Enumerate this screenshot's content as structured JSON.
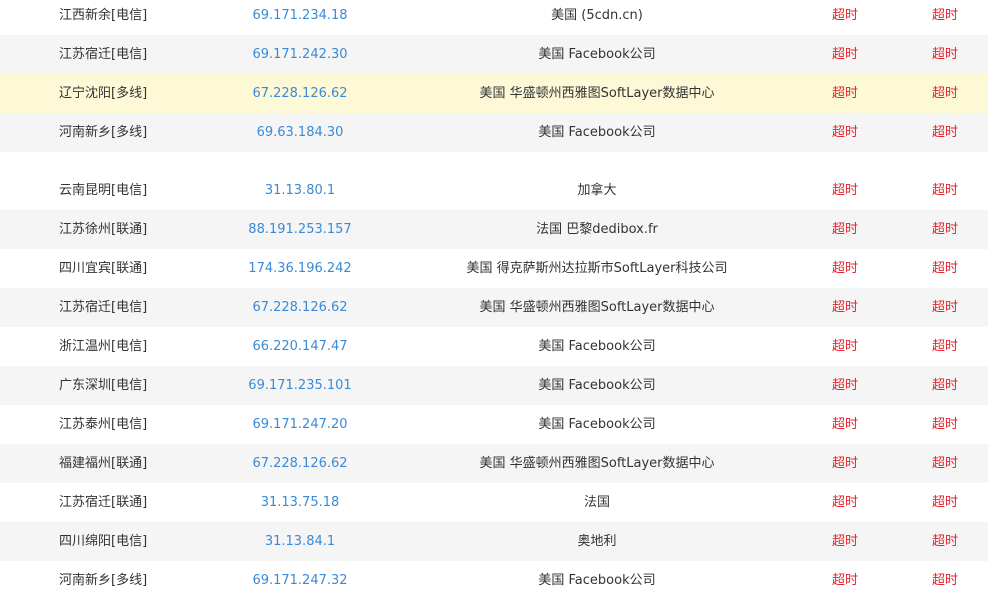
{
  "rows": [
    {
      "location": "江西新余[电信]",
      "ip": "69.171.234.18",
      "geo": "美国 (5cdn.cn)",
      "result1": "超时",
      "result2": "超时",
      "highlighted": false
    },
    {
      "location": "江苏宿迁[电信]",
      "ip": "69.171.242.30",
      "geo": "美国 Facebook公司",
      "result1": "超时",
      "result2": "超时",
      "highlighted": false
    },
    {
      "location": "辽宁沈阳[多线]",
      "ip": "67.228.126.62",
      "geo": "美国 华盛顿州西雅图SoftLayer数据中心",
      "result1": "超时",
      "result2": "超时",
      "highlighted": true
    },
    {
      "location": "河南新乡[多线]",
      "ip": "69.63.184.30",
      "geo": "美国 Facebook公司",
      "result1": "超时",
      "result2": "超时",
      "highlighted": false
    },
    {
      "location": "云南昆明[电信]",
      "ip": "31.13.80.1",
      "geo": "加拿大",
      "result1": "超时",
      "result2": "超时",
      "highlighted": false
    },
    {
      "location": "江苏徐州[联通]",
      "ip": "88.191.253.157",
      "geo": "法国 巴黎dedibox.fr",
      "result1": "超时",
      "result2": "超时",
      "highlighted": false
    },
    {
      "location": "四川宜宾[联通]",
      "ip": "174.36.196.242",
      "geo": "美国 得克萨斯州达拉斯市SoftLayer科技公司",
      "result1": "超时",
      "result2": "超时",
      "highlighted": false
    },
    {
      "location": "江苏宿迁[电信]",
      "ip": "67.228.126.62",
      "geo": "美国 华盛顿州西雅图SoftLayer数据中心",
      "result1": "超时",
      "result2": "超时",
      "highlighted": false
    },
    {
      "location": "浙江温州[电信]",
      "ip": "66.220.147.47",
      "geo": "美国 Facebook公司",
      "result1": "超时",
      "result2": "超时",
      "highlighted": false
    },
    {
      "location": "广东深圳[电信]",
      "ip": "69.171.235.101",
      "geo": "美国 Facebook公司",
      "result1": "超时",
      "result2": "超时",
      "highlighted": false
    },
    {
      "location": "江苏泰州[电信]",
      "ip": "69.171.247.20",
      "geo": "美国 Facebook公司",
      "result1": "超时",
      "result2": "超时",
      "highlighted": false
    },
    {
      "location": "福建福州[联通]",
      "ip": "67.228.126.62",
      "geo": "美国 华盛顿州西雅图SoftLayer数据中心",
      "result1": "超时",
      "result2": "超时",
      "highlighted": false
    },
    {
      "location": "江苏宿迁[联通]",
      "ip": "31.13.75.18",
      "geo": "法国",
      "result1": "超时",
      "result2": "超时",
      "highlighted": false
    },
    {
      "location": "四川绵阳[电信]",
      "ip": "31.13.84.1",
      "geo": "奥地利",
      "result1": "超时",
      "result2": "超时",
      "highlighted": false
    },
    {
      "location": "河南新乡[多线]",
      "ip": "69.171.247.32",
      "geo": "美国 Facebook公司",
      "result1": "超时",
      "result2": "超时",
      "highlighted": false
    }
  ]
}
